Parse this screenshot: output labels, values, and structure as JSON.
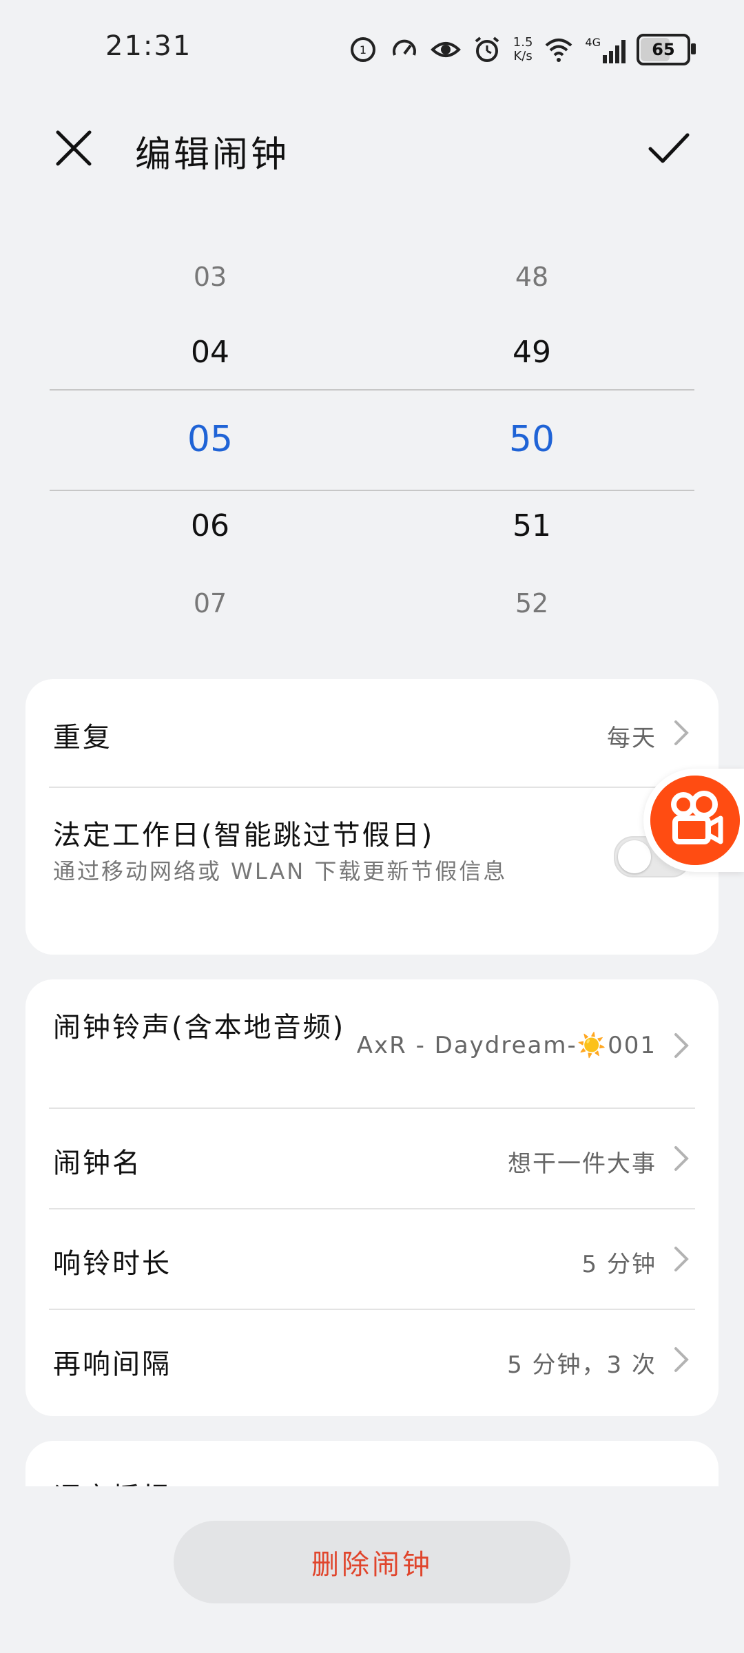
{
  "status_bar": {
    "time": "21:31",
    "net_speed_value": "1.5",
    "net_speed_unit": "K/s",
    "network": "4G",
    "battery": "65"
  },
  "header": {
    "title": "编辑闹钟"
  },
  "picker": {
    "hours": [
      "03",
      "04",
      "05",
      "06",
      "07"
    ],
    "minutes": [
      "48",
      "49",
      "50",
      "51",
      "52"
    ],
    "selected_color": "#1f63d6"
  },
  "settings_card1": {
    "repeat_label": "重复",
    "repeat_value": "每天",
    "workday_label": "法定工作日(智能跳过节假日)",
    "workday_desc": "通过移动网络或 WLAN 下载更新节假信息",
    "workday_toggle": "off"
  },
  "settings_card2": {
    "ringtone_label": "闹钟铃声(含本地音频)",
    "ringtone_value": "AxR - Daydream-☀️001",
    "name_label": "闹钟名",
    "name_value": "想干一件大事",
    "duration_label": "响铃时长",
    "duration_value": "5 分钟",
    "snooze_label": "再响间隔",
    "snooze_value": "5 分钟，3 次"
  },
  "settings_card3": {
    "partial_label": "语音播报"
  },
  "footer": {
    "delete_label": "删除闹钟",
    "delete_color": "#e0452c"
  },
  "icons": {
    "close": "close-icon",
    "confirm": "check-icon",
    "chevron": "chevron-right-icon",
    "floating": "kuaishou-icon"
  }
}
